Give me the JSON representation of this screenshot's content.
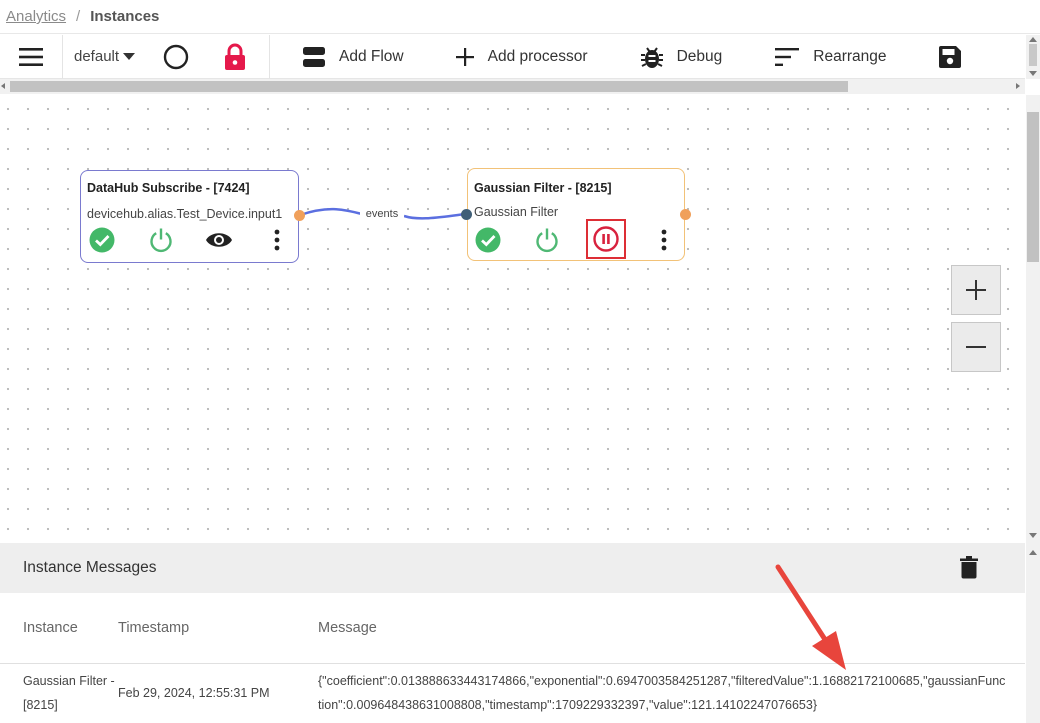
{
  "breadcrumb": {
    "parent": "Analytics",
    "separator": "/",
    "current": "Instances"
  },
  "toolbar": {
    "flow_selected": "default",
    "add_flow": "Add Flow",
    "add_processor": "Add processor",
    "debug": "Debug",
    "rearrange": "Rearrange"
  },
  "nodes": [
    {
      "title": "DataHub Subscribe - [7424]",
      "subtitle": "devicehub.alias.Test_Device.input1",
      "border_color": "#7a7acf"
    },
    {
      "title": "Gaussian Filter - [8215]",
      "subtitle": "Gaussian Filter",
      "border_color": "#f2c278"
    }
  ],
  "edge": {
    "label": "events",
    "color": "#5b6fe0"
  },
  "zoom": {
    "in": "+",
    "out": "−"
  },
  "messages": {
    "title": "Instance Messages",
    "columns": {
      "instance": "Instance",
      "timestamp": "Timestamp",
      "message": "Message"
    },
    "rows": [
      {
        "instance": "Gaussian Filter - [8215]",
        "timestamp": "Feb 29, 2024, 12:55:31 PM",
        "message": "{\"coefficient\":0.013888633443174866,\"exponential\":0.6947003584251287,\"filteredValue\":1.16882172100685,\"gaussianFunction\":0.009648438631008808,\"timestamp\":1709229332397,\"value\":121.14102247076653}"
      }
    ]
  },
  "colors": {
    "status_ok": "#43b868",
    "power": "#4fb874",
    "pause": "#d8223e",
    "lock": "#e5194b",
    "highlight_box": "#dd2e35",
    "annotation_arrow": "#e8453c"
  },
  "icons": [
    "menu-icon",
    "circle-icon",
    "lock-icon",
    "add-flow-icon",
    "plus-icon",
    "bug-icon",
    "sort-icon",
    "save-icon",
    "check-circle-icon",
    "power-icon",
    "eye-icon",
    "more-vert-icon",
    "pause-circle-icon",
    "trash-icon"
  ]
}
